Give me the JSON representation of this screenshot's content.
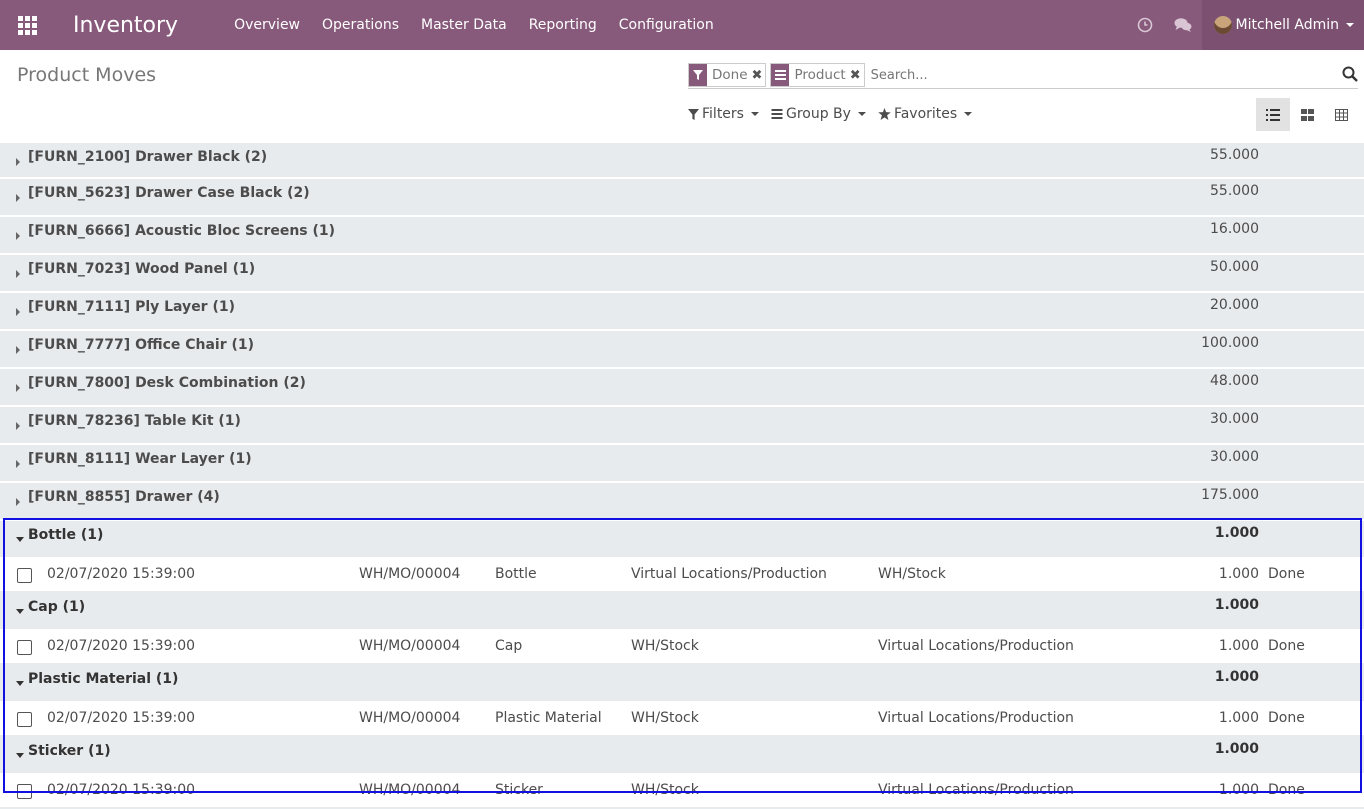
{
  "navbar": {
    "app_title": "Inventory",
    "menu": [
      "Overview",
      "Operations",
      "Master Data",
      "Reporting",
      "Configuration"
    ],
    "user_name": "Mitchell Admin"
  },
  "control": {
    "page_title": "Product Moves",
    "facets": [
      {
        "icon": "filter-icon",
        "value": "Done"
      },
      {
        "icon": "group-by-icon",
        "value": "Product"
      }
    ],
    "search_placeholder": "Search...",
    "filters_label": "Filters",
    "groupby_label": "Group By",
    "favorites_label": "Favorites"
  },
  "collapsed_groups": [
    {
      "label": "[FURN_2100] Drawer Black (2)",
      "qty": "55.000"
    },
    {
      "label": "[FURN_5623] Drawer Case Black (2)",
      "qty": "55.000"
    },
    {
      "label": "[FURN_6666] Acoustic Bloc Screens (1)",
      "qty": "16.000"
    },
    {
      "label": "[FURN_7023] Wood Panel (1)",
      "qty": "50.000"
    },
    {
      "label": "[FURN_7111] Ply Layer (1)",
      "qty": "20.000"
    },
    {
      "label": "[FURN_7777] Office Chair (1)",
      "qty": "100.000"
    },
    {
      "label": "[FURN_7800] Desk Combination (2)",
      "qty": "48.000"
    },
    {
      "label": "[FURN_78236] Table Kit (1)",
      "qty": "30.000"
    },
    {
      "label": "[FURN_8111] Wear Layer (1)",
      "qty": "30.000"
    },
    {
      "label": "[FURN_8855] Drawer (4)",
      "qty": "175.000"
    }
  ],
  "open_groups": [
    {
      "label": "Bottle (1)",
      "qty": "1.000",
      "row": {
        "date": "02/07/2020 15:39:00",
        "ref": "WH/MO/00004",
        "product": "Bottle",
        "from": "Virtual Locations/Production",
        "to": "WH/Stock",
        "qty": "1.000",
        "status": "Done"
      }
    },
    {
      "label": "Cap (1)",
      "qty": "1.000",
      "row": {
        "date": "02/07/2020 15:39:00",
        "ref": "WH/MO/00004",
        "product": "Cap",
        "from": "WH/Stock",
        "to": "Virtual Locations/Production",
        "qty": "1.000",
        "status": "Done"
      }
    },
    {
      "label": "Plastic Material (1)",
      "qty": "1.000",
      "row": {
        "date": "02/07/2020 15:39:00",
        "ref": "WH/MO/00004",
        "product": "Plastic Material",
        "from": "WH/Stock",
        "to": "Virtual Locations/Production",
        "qty": "1.000",
        "status": "Done"
      }
    },
    {
      "label": "Sticker (1)",
      "qty": "1.000",
      "row": {
        "date": "02/07/2020 15:39:00",
        "ref": "WH/MO/00004",
        "product": "Sticker",
        "from": "WH/Stock",
        "to": "Virtual Locations/Production",
        "qty": "1.000",
        "status": "Done"
      }
    }
  ],
  "colors": {
    "brand": "#875a7b",
    "group_bg": "#e8ebee",
    "highlight": "#1010e0"
  }
}
